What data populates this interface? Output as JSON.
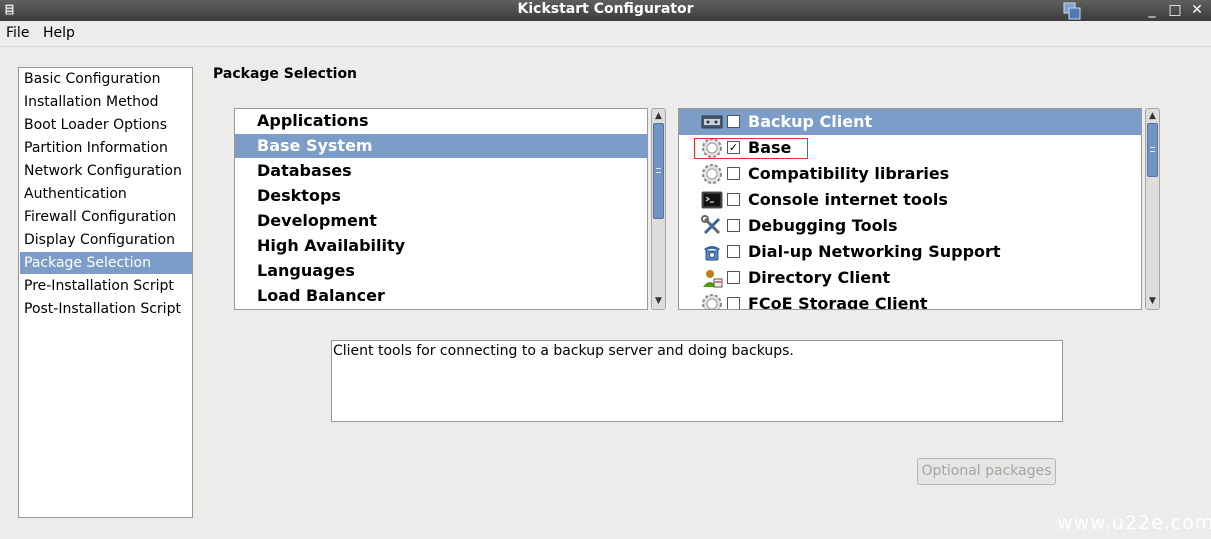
{
  "window": {
    "title": "Kickstart Configurator",
    "controls": {
      "minimize": "_",
      "maximize": "□",
      "close": "✕"
    }
  },
  "menubar": {
    "items": [
      "File",
      "Help"
    ]
  },
  "sidebar": {
    "items": [
      "Basic Configuration",
      "Installation Method",
      "Boot Loader Options",
      "Partition Information",
      "Network Configuration",
      "Authentication",
      "Firewall Configuration",
      "Display Configuration",
      "Package Selection",
      "Pre-Installation Script",
      "Post-Installation Script"
    ],
    "selected": "Package Selection"
  },
  "main": {
    "title": "Package Selection",
    "categories": [
      "Applications",
      "Base System",
      "Databases",
      "Desktops",
      "Development",
      "High Availability",
      "Languages",
      "Load Balancer"
    ],
    "selected_category": "Base System",
    "packages": [
      {
        "label": "Backup Client",
        "checked": false,
        "icon": "backup-drive-icon",
        "selected": true
      },
      {
        "label": "Base",
        "checked": true,
        "icon": "gear-icon",
        "selected": false
      },
      {
        "label": "Compatibility libraries",
        "checked": false,
        "icon": "gear-icon",
        "selected": false
      },
      {
        "label": "Console internet tools",
        "checked": false,
        "icon": "terminal-icon",
        "selected": false
      },
      {
        "label": "Debugging Tools",
        "checked": false,
        "icon": "tools-icon",
        "selected": false
      },
      {
        "label": "Dial-up Networking Support",
        "checked": false,
        "icon": "telephone-icon",
        "selected": false
      },
      {
        "label": "Directory Client",
        "checked": false,
        "icon": "directory-user-icon",
        "selected": false
      },
      {
        "label": "FCoE Storage Client",
        "checked": false,
        "icon": "gear-icon",
        "selected": false
      }
    ],
    "description": "Client tools for connecting to a backup server and doing backups.",
    "optional_button": "Optional packages"
  },
  "watermark": "www.u22e.com",
  "colors": {
    "selection": "#7b9dc8",
    "highlight_border": "#e03030"
  }
}
